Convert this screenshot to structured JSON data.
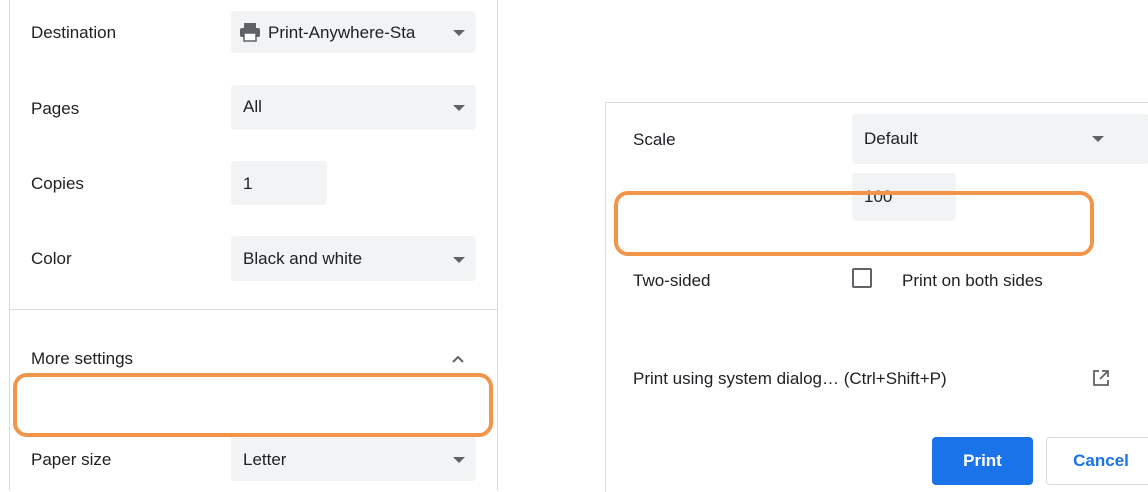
{
  "left": {
    "destination": {
      "label": "Destination",
      "value": "Print-Anywhere-Sta",
      "icon": "printer-icon"
    },
    "pages": {
      "label": "Pages",
      "value": "All"
    },
    "copies": {
      "label": "Copies",
      "value": "1"
    },
    "color": {
      "label": "Color",
      "value": "Black and white"
    },
    "more_settings": {
      "label": "More settings",
      "icon": "chevron-up-icon"
    },
    "paper_size": {
      "label": "Paper size",
      "value": "Letter"
    }
  },
  "right": {
    "scale": {
      "label": "Scale",
      "value": "Default"
    },
    "scale_custom": {
      "value": "100"
    },
    "two_sided": {
      "label": "Two-sided",
      "checkbox_label": "Print on both sides",
      "checked": false
    },
    "system_dialog": {
      "label": "Print using system dialog… (Ctrl+Shift+P)",
      "icon": "open-external-icon"
    },
    "print_button": "Print",
    "cancel_button": "Cancel"
  },
  "colors": {
    "highlight": "#f0954a",
    "accent": "#1a73e8",
    "field_bg": "#f1f3f4"
  }
}
